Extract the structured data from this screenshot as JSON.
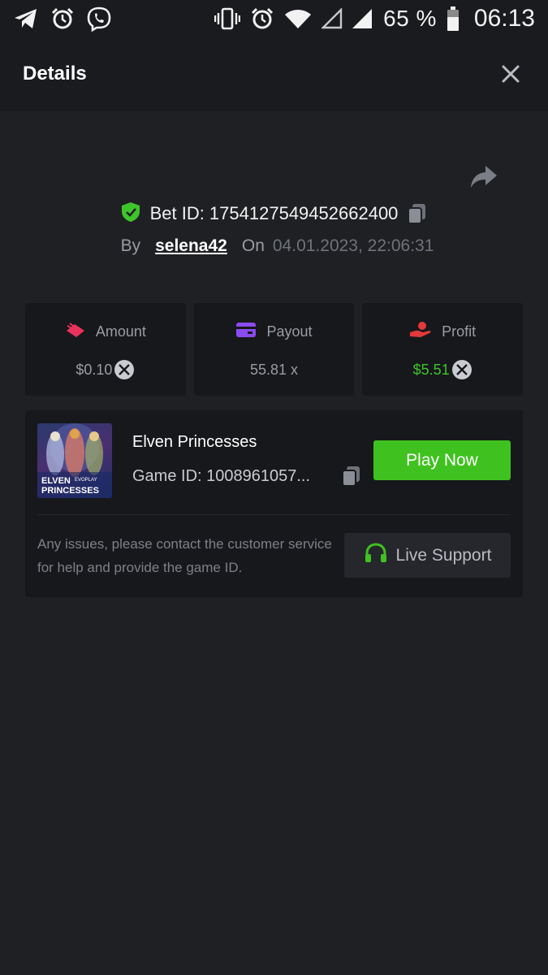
{
  "status_bar": {
    "battery_text": "65 %",
    "time": "06:13",
    "icons": [
      "telegram-icon",
      "alarm-icon",
      "viber-icon",
      "vibrate-icon",
      "alarm-icon",
      "wifi-icon",
      "signal-empty-icon",
      "signal-icon",
      "battery-icon"
    ]
  },
  "header": {
    "title": "Details"
  },
  "bet": {
    "id_text": "Bet ID: 1754127549452662400",
    "by_label": "By",
    "username": "selena42",
    "on_label": "On",
    "datetime": "04.01.2023, 22:06:31"
  },
  "stats": {
    "amount": {
      "label": "Amount",
      "value": "$0.10"
    },
    "payout": {
      "label": "Payout",
      "value": "55.81 x"
    },
    "profit": {
      "label": "Profit",
      "value": "$5.51"
    }
  },
  "game": {
    "name": "Elven Princesses",
    "game_id_text": "Game ID: 1008961057...",
    "thumb_title_line1": "ELVEN",
    "thumb_brand": "EVOPLAY",
    "thumb_title_line2": "PRINCESSES",
    "play_label": "Play Now",
    "help_text": "Any issues, please contact the customer service for help and provide the game ID.",
    "support_label": "Live Support"
  },
  "colors": {
    "background": "#1f2024",
    "panel": "#17181b",
    "accent_green": "#3fc21f",
    "profit_green": "#3ec52a",
    "amount_icon": "#e8335c",
    "payout_icon": "#8a4bf0",
    "profit_icon": "#e23a3a"
  }
}
